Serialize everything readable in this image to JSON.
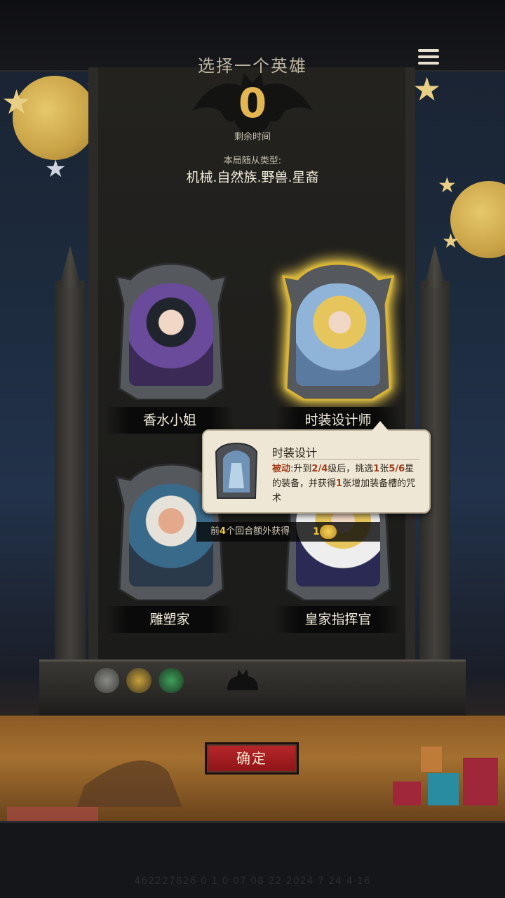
{
  "header": {
    "title": "选择一个英雄",
    "menu_icon": "hamburger-menu-icon"
  },
  "timer": {
    "value": "0",
    "label": "剩余时间"
  },
  "minion_types": {
    "label": "本局随从类型:",
    "list": "机械.自然族.野兽.星裔"
  },
  "heroes": [
    {
      "name": "香水小姐",
      "selected": false
    },
    {
      "name": "时装设计师",
      "selected": true
    },
    {
      "name": "雕塑家",
      "selected": false
    },
    {
      "name": "皇家指挥官",
      "selected": false
    }
  ],
  "tooltip": {
    "title": "时装设计",
    "kw": "被动",
    "t1": ":升到",
    "n1": "2/4",
    "t2": "级后，挑选",
    "n2": "1",
    "t3": "张",
    "n3": "5/6",
    "t4": "星的装备，并获得",
    "n4": "1",
    "t5": "张增加装备槽的咒术"
  },
  "bonus": {
    "prefix": "前",
    "count": "4",
    "suffix": "个回合额外获得",
    "amount": "1"
  },
  "confirm_label": "确定",
  "watermark": "462227826 0 1 0 07 08 22 2024 7 24 4 16"
}
